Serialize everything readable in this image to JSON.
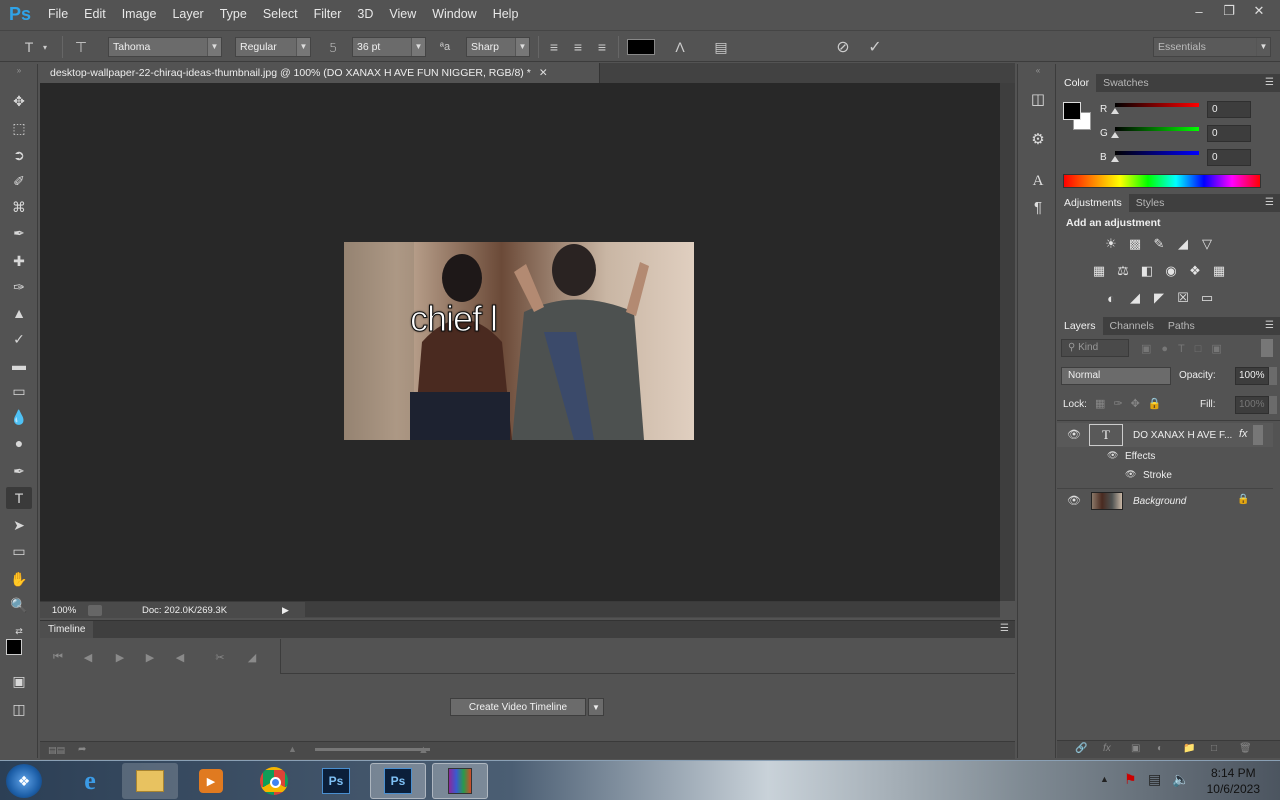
{
  "app": {
    "logo": "Ps",
    "menu": [
      "File",
      "Edit",
      "Image",
      "Layer",
      "Type",
      "Select",
      "Filter",
      "3D",
      "View",
      "Window",
      "Help"
    ]
  },
  "options_bar": {
    "font_family": "Tahoma",
    "font_style": "Regular",
    "font_size": "36 pt",
    "aa_label": "ªa",
    "antialias": "Sharp",
    "workspace": "Essentials",
    "text_color": "#000000"
  },
  "document": {
    "tab_title": "desktop-wallpaper-22-chiraq-ideas-thumbnail.jpg @ 100% (DO XANAX H AVE FUN NIGGER, RGB/8) *",
    "overlay_text": "chief l",
    "zoom": "100%",
    "doc_info": "Doc: 202.0K/269.3K"
  },
  "timeline": {
    "tab": "Timeline",
    "create_button": "Create Video Timeline"
  },
  "color_panel": {
    "tabs": [
      "Color",
      "Swatches"
    ],
    "r_label": "R",
    "g_label": "G",
    "b_label": "B",
    "r": "0",
    "g": "0",
    "b": "0"
  },
  "adjustments_panel": {
    "tabs": [
      "Adjustments",
      "Styles"
    ],
    "heading": "Add an adjustment"
  },
  "layers_panel": {
    "tabs": [
      "Layers",
      "Channels",
      "Paths"
    ],
    "kind_filter": "Kind",
    "blend_mode": "Normal",
    "opacity_label": "Opacity:",
    "opacity": "100%",
    "lock_label": "Lock:",
    "fill_label": "Fill:",
    "fill": "100%",
    "layers": [
      {
        "name": "DO XANAX H AVE F...",
        "type": "text",
        "fx": "fx"
      },
      {
        "name": "Effects",
        "type": "effects"
      },
      {
        "name": "Stroke",
        "type": "effect"
      },
      {
        "name": "Background",
        "type": "image"
      }
    ]
  },
  "taskbar": {
    "time": "8:14 PM",
    "date": "10/6/2023"
  }
}
